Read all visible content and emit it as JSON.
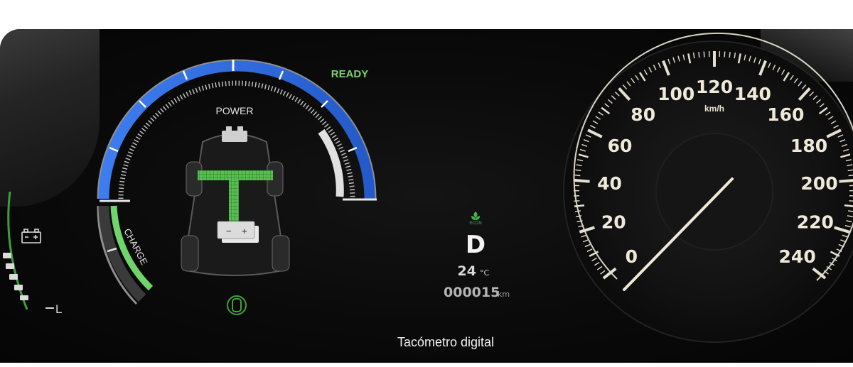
{
  "power_gauge": {
    "power_label": "POWER",
    "charge_label": "CHARGE",
    "ready_label": "READY",
    "battery_minus": "−",
    "battery_plus": "+"
  },
  "side_gauge": {
    "low_label": "L"
  },
  "center_display": {
    "econ_label": "ECON",
    "gear": "D",
    "temperature_value": "24",
    "temperature_unit": "°C",
    "odometer_value": "000015",
    "odometer_unit": "km"
  },
  "speedometer": {
    "unit": "km/h",
    "labels": [
      "0",
      "20",
      "40",
      "60",
      "80",
      "100",
      "120",
      "140",
      "160",
      "180",
      "200",
      "220",
      "240"
    ],
    "current_speed": 0
  },
  "caption": "Tacómetro digital",
  "colors": {
    "blue": "#2f6fe0",
    "green": "#6fd46a",
    "ready_green": "#7ad36b",
    "needle": "#f0e9d8"
  }
}
